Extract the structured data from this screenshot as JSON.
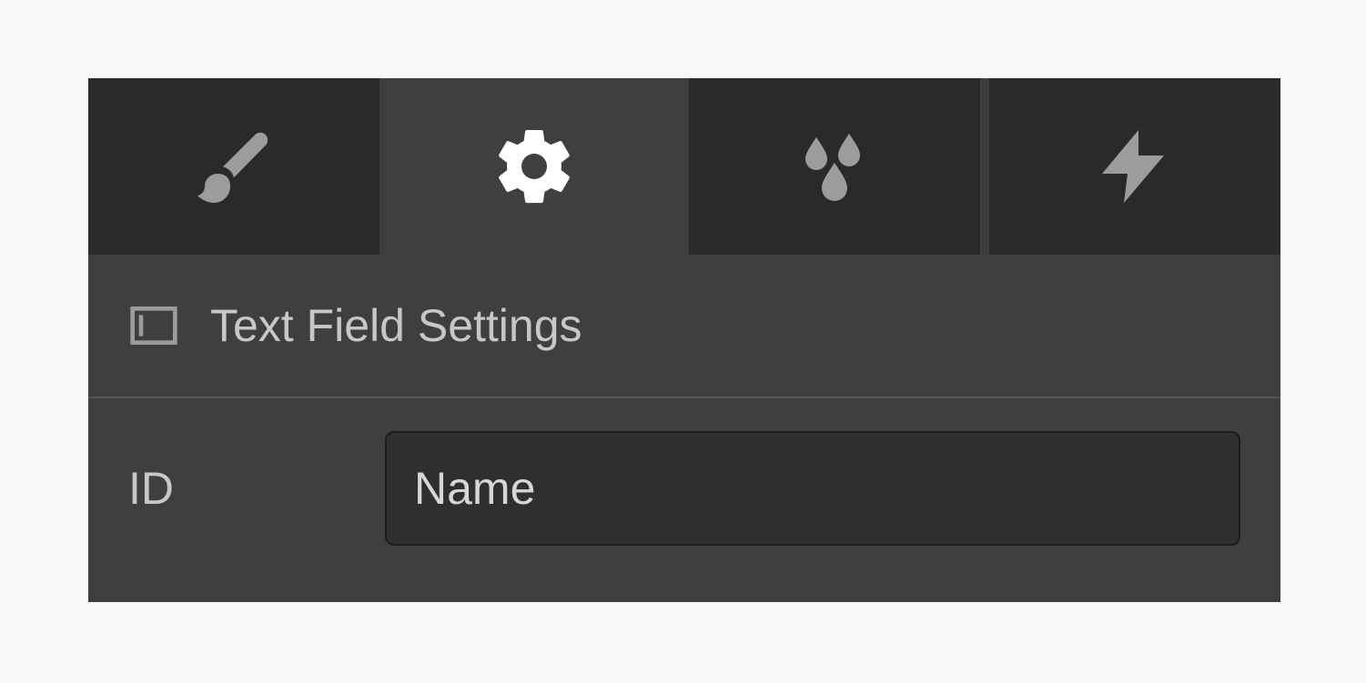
{
  "tabs": {
    "items": [
      {
        "name": "brush-tab",
        "icon": "brush-icon"
      },
      {
        "name": "settings-tab",
        "icon": "gear-icon"
      },
      {
        "name": "effects-tab",
        "icon": "droplets-icon"
      },
      {
        "name": "actions-tab",
        "icon": "bolt-icon"
      }
    ],
    "active_index": 1
  },
  "section": {
    "title": "Text Field Settings",
    "icon": "text-field-icon"
  },
  "fields": {
    "id": {
      "label": "ID",
      "value": "Name"
    }
  }
}
